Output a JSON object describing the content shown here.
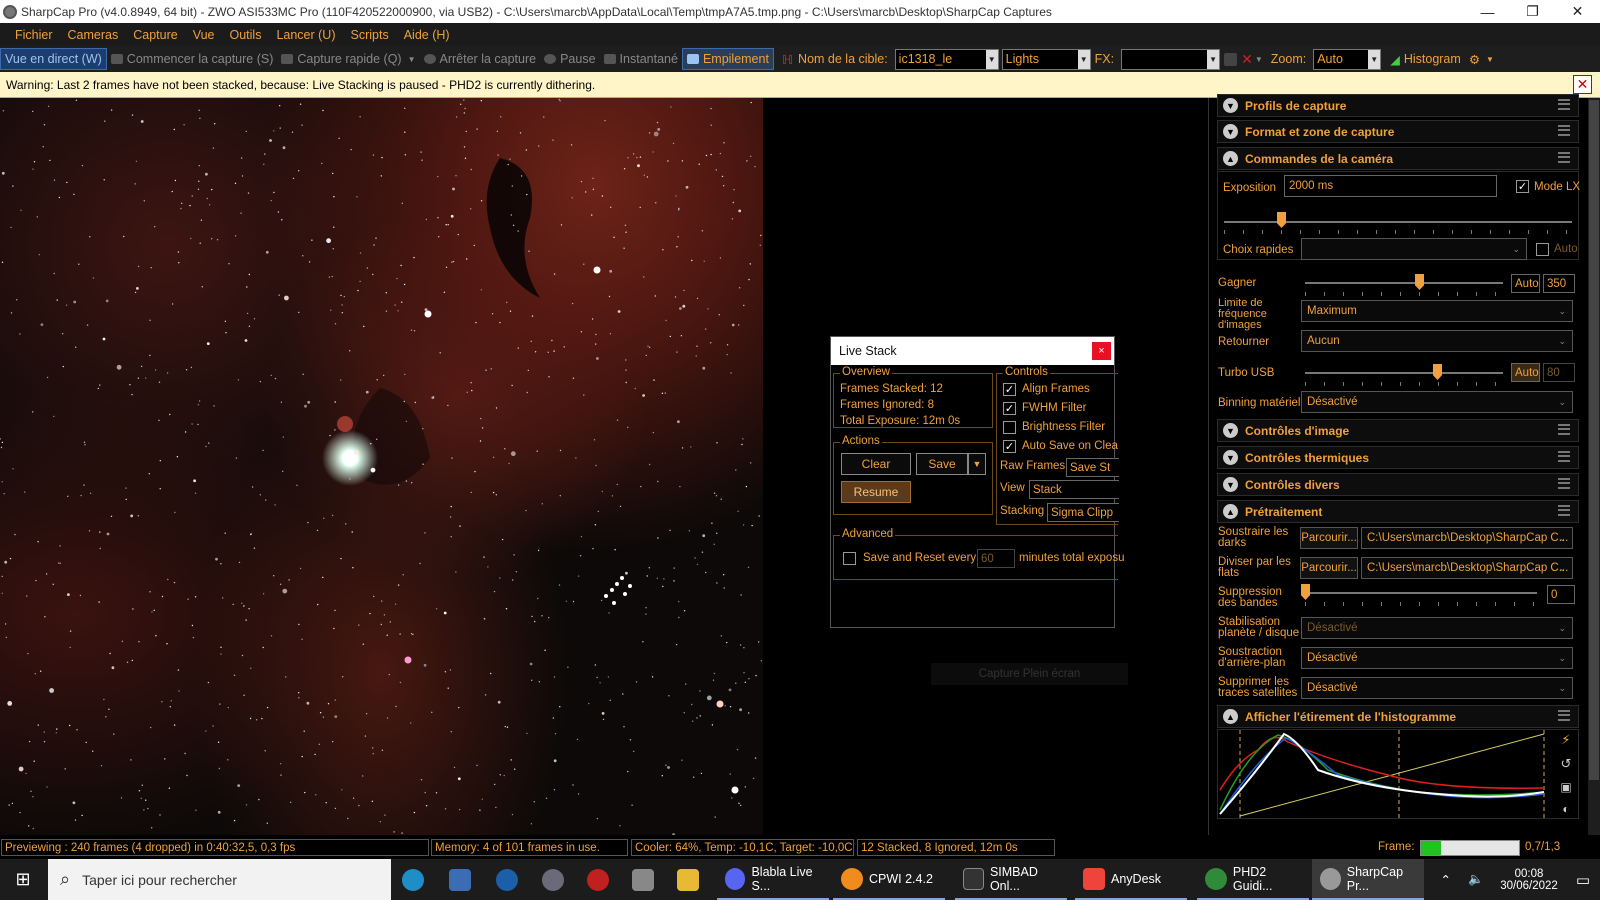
{
  "window": {
    "title": "SharpCap Pro (v4.0.8949, 64 bit) - ZWO ASI533MC Pro (110F420522000900, via USB2) - C:\\Users\\marcb\\AppData\\Local\\Temp\\tmpA7A5.tmp.png - C:\\Users\\marcb\\Desktop\\SharpCap Captures",
    "minimize": "—",
    "maximize": "❐",
    "close": "✕"
  },
  "menu": [
    "Fichier",
    "Cameras",
    "Capture",
    "Vue",
    "Outils",
    "Lancer (U)",
    "Scripts",
    "Aide (H)"
  ],
  "toolbar": {
    "live": "Vue en direct (W)",
    "start_capture": "Commencer la capture (S)",
    "quick_capture": "Capture rapide (Q)",
    "stop_capture": "Arrêter la capture",
    "pause": "Pause",
    "snapshot": "Instantané",
    "stacking": "Empilement",
    "target_label": "Nom de la cible:",
    "target_value": "ic1318_le",
    "frame_type": "Lights",
    "fx_label": "FX:",
    "fx_value": "",
    "zoom_label": "Zoom:",
    "zoom_value": "Auto",
    "histogram": "Histogram"
  },
  "warning": "Warning: Last 2 frames have not been stacked, because: Live Stacking is paused - PHD2 is currently dithering.",
  "live_stack": {
    "title": "Live Stack",
    "close": "×",
    "overview_label": "Overview",
    "frames_stacked": "Frames Stacked:  12",
    "frames_ignored": "Frames Ignored:  8",
    "total_exposure": "Total Exposure:   12m 0s",
    "actions_label": "Actions",
    "clear": "Clear",
    "save": "Save",
    "resume": "Resume",
    "controls_label": "Controls",
    "align_frames": "Align Frames",
    "fwhm_filter": "FWHM Filter",
    "brightness_filter": "Brightness Filter",
    "auto_save": "Auto Save on Clea",
    "raw_frames_label": "Raw Frames",
    "raw_frames_value": "Save St",
    "view_label": "View",
    "view_value": "Stack",
    "stacking_label": "Stacking",
    "stacking_value": "Sigma Clipp",
    "advanced_label": "Advanced",
    "save_reset": "Save and Reset every",
    "save_reset_value": "60",
    "minutes_total": "minutes total exposu",
    "capture_fullscreen": "Capture Plein écran"
  },
  "panel": {
    "profils": "Profils de capture",
    "format": "Format et zone de capture",
    "commandes": "Commandes de la caméra",
    "exposition_label": "Exposition",
    "exposition_value": "2000 ms",
    "mode_lx": "Mode LX",
    "choix_rapides": "Choix rapides",
    "auto": "Auto",
    "gagner": "Gagner",
    "gain_auto": "Auto",
    "gain_value": "350",
    "limite": "Limite de fréquence d'images",
    "limite_value": "Maximum",
    "retourner": "Retourner",
    "retourner_value": "Aucun",
    "turbo": "Turbo USB",
    "turbo_auto": "Auto",
    "turbo_value": "80",
    "binning": "Binning matériel",
    "binning_value": "Désactivé",
    "controles_image": "Contrôles d'image",
    "controles_thermiques": "Contrôles thermiques",
    "controles_divers": "Contrôles divers",
    "pretraitement": "Prétraitement",
    "soustraire": "Soustraire les darks",
    "parcourir": "Parcourir...",
    "darks_path": "C:\\Users\\marcb\\Desktop\\SharpCap C...",
    "diviser": "Diviser par les flats",
    "flats_path": "C:\\Users\\marcb\\Desktop\\SharpCap C...",
    "suppression": "Suppression des bandes",
    "suppression_value": "0",
    "stabilisation": "Stabilisation planète / disque",
    "stabilisation_value": "Désactivé",
    "soustraction": "Soustraction d'arrière-plan",
    "soustraction_value": "Désactivé",
    "supprimer": "Supprimer les traces satellites",
    "supprimer_value": "Désactivé",
    "histogramme": "Afficher l'étirement de l'histogramme"
  },
  "status": {
    "previewing": "Previewing : 240 frames (4 dropped) in 0:40:32,5, 0,3 fps",
    "memory": "Memory: 4 of 101 frames in use.",
    "cooler": "Cooler: 64%, Temp: -10,1C, Target: -10,0C",
    "stacked": "12 Stacked, 8 Ignored, 12m 0s",
    "frame_label": "Frame:",
    "frame_value": "0,7/1,3",
    "frame_progress": 0.2
  },
  "taskbar": {
    "search": "Taper ici pour rechercher",
    "apps": [
      "Blabla Live S...",
      "CPWI 2.4.2",
      "SIMBAD Onl...",
      "AnyDesk",
      "PHD2 Guidi...",
      "SharpCap Pr..."
    ],
    "time": "00:08",
    "date": "30/06/2022"
  },
  "colors": {
    "accent": "#f0a03c",
    "nebula": "#6d2318",
    "warning_bg": "#fff5c9"
  }
}
